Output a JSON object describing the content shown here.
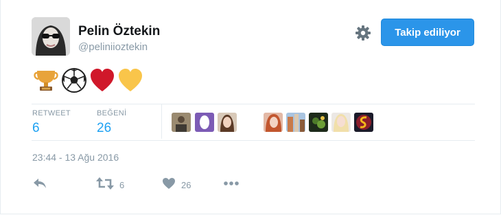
{
  "profile": {
    "name": "Pelin Öztekin",
    "handle": "@peliniioztekin"
  },
  "follow_button": {
    "label": "Takip ediliyor"
  },
  "tweet": {
    "emojis": [
      "trophy-icon",
      "soccer-ball-icon",
      "red-heart-icon",
      "yellow-heart-icon"
    ],
    "timestamp": "23:44 - 13 Ağu 2016"
  },
  "stats": {
    "retweet_label": "RETWEET",
    "retweet_count": "6",
    "like_label": "BEĞENİ",
    "like_count": "26"
  },
  "likers": [
    "liker-avatar-1",
    "liker-avatar-2",
    "liker-avatar-3",
    "liker-avatar-4",
    "liker-avatar-5",
    "liker-avatar-6",
    "liker-avatar-7",
    "liker-avatar-8"
  ],
  "actions": {
    "retweet_count": "6",
    "like_count": "26"
  },
  "colors": {
    "accent": "#1da1f2",
    "button": "#2b95e9",
    "muted": "#8899a6",
    "heart_red": "#d0182a",
    "heart_yellow": "#f9c54a",
    "trophy": "#e8a33a"
  }
}
